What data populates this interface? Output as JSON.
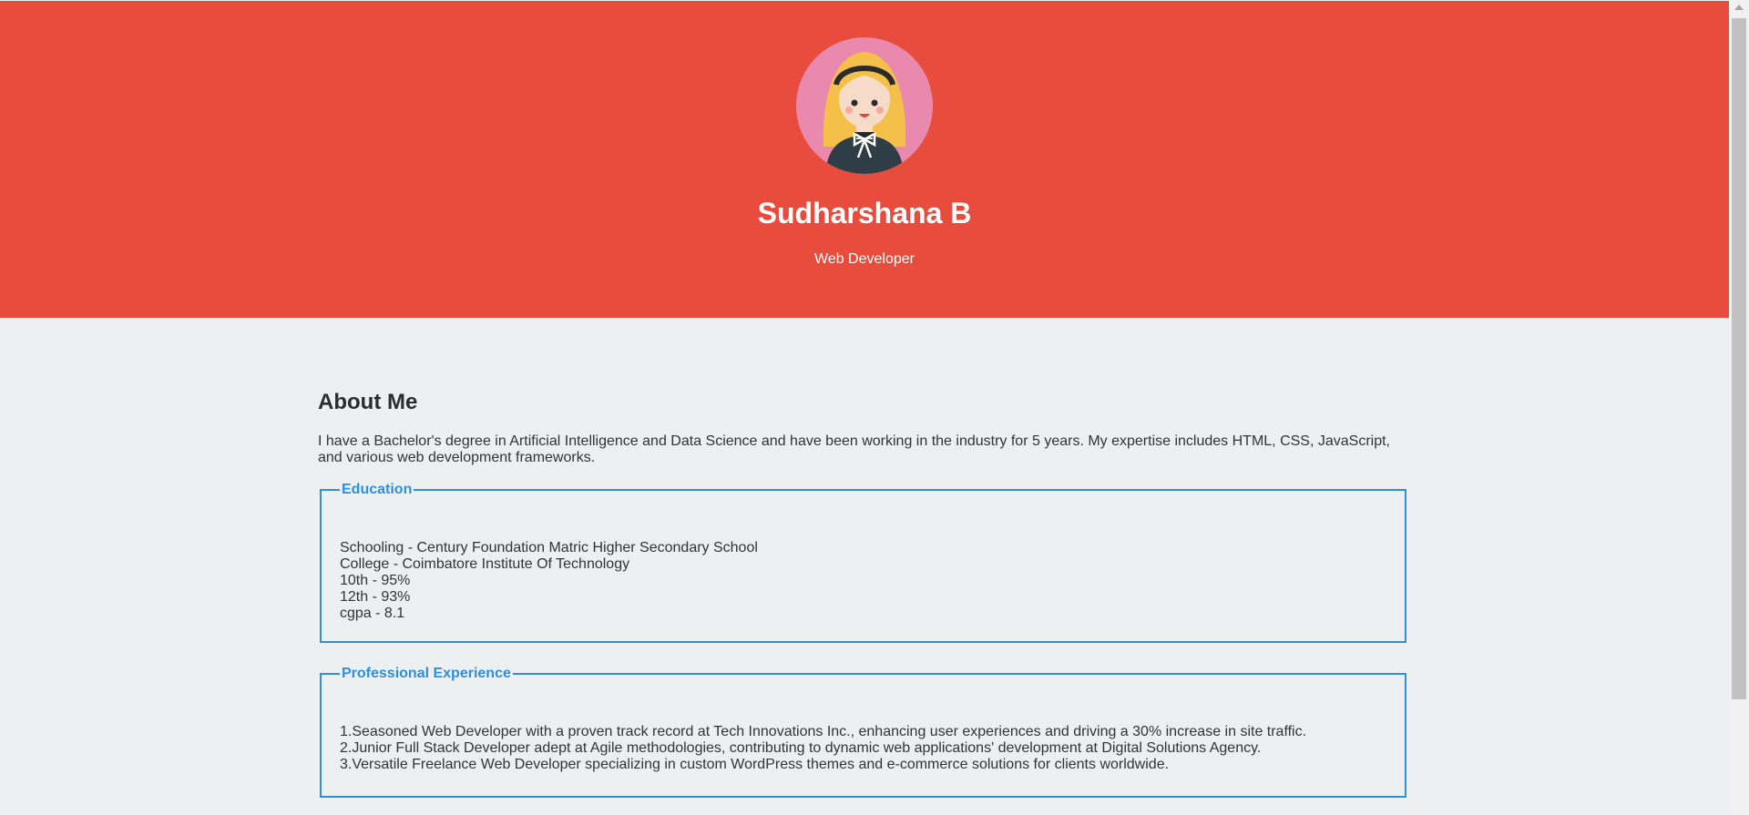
{
  "header": {
    "avatar_icon": "woman-avatar-icon",
    "name": "Sudharshana B",
    "role": "Web Developer",
    "bg_color": "#e74c3c"
  },
  "about": {
    "title": "About Me",
    "text": "I have a Bachelor's degree in Artificial Intelligence and Data Science and have been working in the industry for 5 years. My expertise includes HTML, CSS, JavaScript, and various web development frameworks."
  },
  "education": {
    "legend": "Education",
    "lines": [
      "Schooling - Century Foundation Matric Higher Secondary School",
      "College - Coimbatore Institute Of Technology",
      "10th - 95%",
      "12th - 93%",
      "cgpa - 8.1"
    ]
  },
  "experience": {
    "legend": "Professional Experience",
    "lines": [
      "1.Seasoned Web Developer with a proven track record at Tech Innovations Inc., enhancing user experiences and driving a 30% increase in site traffic.",
      "2.Junior Full Stack Developer adept at Agile methodologies, contributing to dynamic web applications' development at Digital Solutions Agency.",
      "3.Versatile Freelance Web Developer specializing in custom WordPress themes and e-commerce solutions for clients worldwide."
    ]
  },
  "colors": {
    "accent": "#2f8fd8",
    "background": "#ecf0f1"
  }
}
